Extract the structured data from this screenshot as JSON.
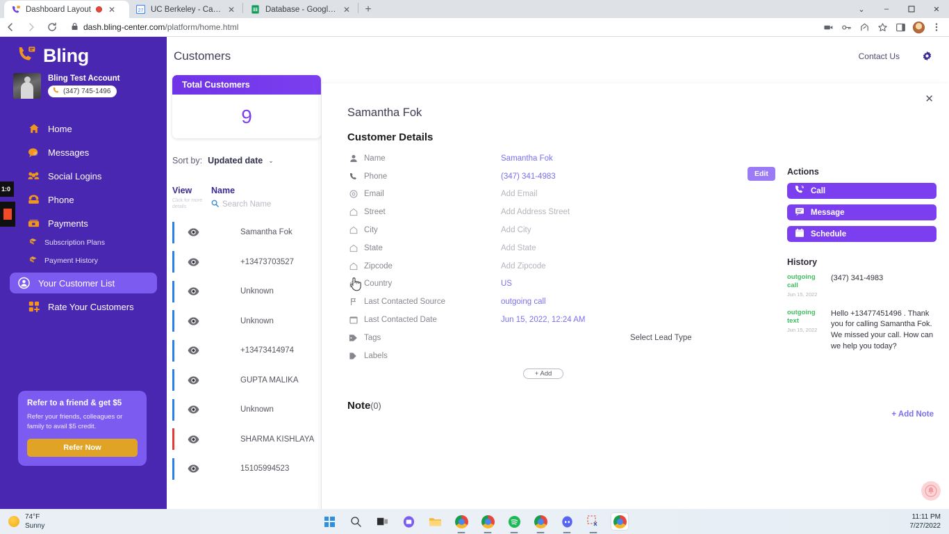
{
  "browser": {
    "tabs": [
      {
        "title": "Dashboard Layout",
        "favicon": "bling-icon",
        "recording": true,
        "active": true
      },
      {
        "title": "UC Berkeley - Calendar - Week o",
        "favicon": "google-calendar-icon",
        "recording": false,
        "active": false
      },
      {
        "title": "Database - Google Sheets",
        "favicon": "google-sheets-icon",
        "recording": false,
        "active": false
      }
    ],
    "new_tab_label": "+",
    "window_controls": {
      "minimize": "–",
      "maximize": "❐",
      "close": "✕",
      "chevron": "⌄"
    },
    "url": "dash.bling-center.com",
    "url_path": "/platform/home.html",
    "toolbar_icons": [
      "back-arrow-icon",
      "forward-arrow-icon",
      "reload-icon",
      "lock-icon",
      "cast-icon",
      "key-icon",
      "share-icon",
      "bookmark-star-icon",
      "sidepanel-icon",
      "profile-avatar-icon",
      "kebab-menu-icon"
    ]
  },
  "sidebar": {
    "brand": "Bling",
    "brand_icon": "bling-phone-icon",
    "account": {
      "name": "Bling Test Account",
      "phone": "(347) 745-1496",
      "phone_icon": "phone-icon",
      "avatar": "account-photo"
    },
    "items": [
      {
        "label": "Home",
        "icon": "home-icon",
        "active": false,
        "sub": false
      },
      {
        "label": "Messages",
        "icon": "chat-bubble-icon",
        "active": false,
        "sub": false
      },
      {
        "label": "Social Logins",
        "icon": "people-icon",
        "active": false,
        "sub": false
      },
      {
        "label": "Phone",
        "icon": "telephone-icon",
        "active": false,
        "sub": false
      },
      {
        "label": "Payments",
        "icon": "money-icon",
        "active": false,
        "sub": false
      },
      {
        "label": "Subscription Plans",
        "icon": "tag-icon",
        "active": false,
        "sub": true
      },
      {
        "label": "Payment History",
        "icon": "tag-icon",
        "active": false,
        "sub": true
      },
      {
        "label": "Your Customer List",
        "icon": "contacts-icon",
        "active": true,
        "sub": false
      },
      {
        "label": "Rate Your Customers",
        "icon": "grid-plus-icon",
        "active": false,
        "sub": false
      }
    ],
    "refer_card": {
      "title": "Refer to a friend & get $5",
      "description": "Refer your friends, colleagues or family to avail $5 credit.",
      "button": "Refer Now"
    },
    "overlays": {
      "timer": "1:0",
      "record_indicator": "stop-recording-icon"
    }
  },
  "header": {
    "title": "Customers",
    "contact_us": "Contact Us",
    "settings_icon": "gear-icon"
  },
  "customer_list": {
    "total_card": {
      "title": "Total Customers",
      "value": "9"
    },
    "sort": {
      "label": "Sort by:",
      "value": "Updated date",
      "caret": "⌄"
    },
    "columns": {
      "view": {
        "title": "View",
        "subtitle": "Click for more details"
      },
      "name": {
        "title": "Name",
        "search_placeholder": "Search Name",
        "search_icon": "search-icon"
      }
    },
    "rows": [
      {
        "name": "Samantha Fok",
        "bar": "blue",
        "selected": true
      },
      {
        "name": "+13473703527",
        "bar": "blue",
        "selected": false
      },
      {
        "name": "Unknown",
        "bar": "blue",
        "selected": false
      },
      {
        "name": "Unknown",
        "bar": "blue",
        "selected": false
      },
      {
        "name": "+13473414974",
        "bar": "blue",
        "selected": false
      },
      {
        "name": "GUPTA MALIKA",
        "bar": "blue",
        "selected": false
      },
      {
        "name": "Unknown",
        "bar": "blue",
        "selected": false
      },
      {
        "name": "SHARMA KISHLAYA",
        "bar": "red",
        "selected": false
      },
      {
        "name": "15105994523",
        "bar": "blue",
        "selected": false
      }
    ]
  },
  "detail": {
    "close_icon": "close-icon",
    "customer_name": "Samantha Fok",
    "section_title": "Customer Details",
    "edit_button": "Edit",
    "fields": [
      {
        "label": "Name",
        "icon": "person-icon",
        "value": "Samantha Fok",
        "style": "link"
      },
      {
        "label": "Phone",
        "icon": "phone-icon",
        "value": "(347) 341-4983",
        "style": "link"
      },
      {
        "label": "Email",
        "icon": "at-icon",
        "value": "Add Email",
        "style": "placeholder"
      },
      {
        "label": "Street",
        "icon": "home-icon",
        "value": "Add Address Street",
        "style": "placeholder"
      },
      {
        "label": "City",
        "icon": "home-icon",
        "value": "Add City",
        "style": "placeholder"
      },
      {
        "label": "State",
        "icon": "home-icon",
        "value": "Add State",
        "style": "placeholder"
      },
      {
        "label": "Zipcode",
        "icon": "home-icon",
        "value": "Add Zipcode",
        "style": "placeholder"
      },
      {
        "label": "Country",
        "icon": "home-icon",
        "value": "US",
        "style": "link"
      },
      {
        "label": "Last Contacted Source",
        "icon": "flag-icon",
        "value": "outgoing call",
        "style": "link"
      },
      {
        "label": "Last Contacted Date",
        "icon": "calendar-icon",
        "value": "Jun 15, 2022, 12:24 AM",
        "style": "link"
      }
    ],
    "tags": {
      "label": "Tags",
      "icon": "tag-icon",
      "value": "Select Lead Type"
    },
    "labels": {
      "label": "Labels",
      "icon": "label-icon",
      "add_button": "+ Add"
    },
    "note": {
      "title": "Note",
      "count": "(0)",
      "add_link": "+ Add Note"
    }
  },
  "actions": {
    "title": "Actions",
    "buttons": [
      {
        "label": "Call",
        "icon": "call-icon"
      },
      {
        "label": "Message",
        "icon": "message-icon"
      },
      {
        "label": "Schedule",
        "icon": "calendar-icon"
      }
    ]
  },
  "history": {
    "title": "History",
    "items": [
      {
        "type": "outgoing call",
        "date": "Jun 15, 2022",
        "body": "(347) 341-4983"
      },
      {
        "type": "outgoing text",
        "date": "Jun 15, 2022",
        "body": "Hello +13477451496 . Thank you for calling Samantha Fok. We missed your call. How can we help you today?"
      }
    ]
  },
  "floating": {
    "bell_icon": "notification-bell-icon"
  },
  "taskbar": {
    "weather": {
      "temperature": "74°F",
      "condition": "Sunny",
      "icon": "sun-icon"
    },
    "apps": [
      "start-windows-icon",
      "search-icon",
      "task-view-icon",
      "teams-icon",
      "file-explorer-icon",
      "chrome-icon",
      "chrome-icon",
      "spotify-icon",
      "chrome-icon",
      "discord-icon",
      "snipping-tool-icon",
      "chrome-icon"
    ],
    "clock": {
      "time": "11:11 PM",
      "date": "7/27/2022"
    }
  },
  "colors": {
    "brand_purple": "#4a27b0",
    "accent_purple": "#7c3ff0",
    "light_purple": "#7c5cf0",
    "orange": "#e8a33a",
    "green": "#3fbf5f",
    "blue_bar": "#2a7fe8",
    "red_bar": "#e53935"
  }
}
